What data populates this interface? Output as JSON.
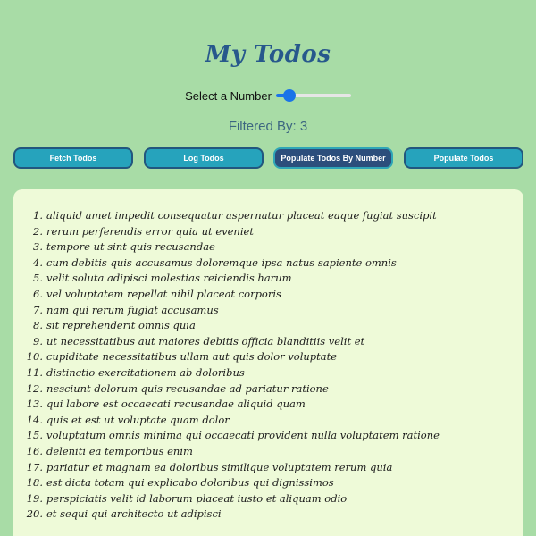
{
  "header": {
    "title": "My Todos"
  },
  "slider": {
    "label": "Select a Number",
    "value_fraction": 0.18
  },
  "filter": {
    "text": "Filtered By: 3"
  },
  "toolbar": {
    "buttons": [
      {
        "label": "Fetch Todos",
        "active": false
      },
      {
        "label": "Log Todos",
        "active": false
      },
      {
        "label": "Populate Todos By Number",
        "active": true
      },
      {
        "label": "Populate Todos",
        "active": false
      }
    ]
  },
  "todos": [
    {
      "num": "1.",
      "text": "aliquid amet impedit consequatur aspernatur placeat eaque fugiat suscipit"
    },
    {
      "num": "2.",
      "text": "rerum perferendis error quia ut eveniet"
    },
    {
      "num": "3.",
      "text": "tempore ut sint quis recusandae"
    },
    {
      "num": "4.",
      "text": "cum debitis quis accusamus doloremque ipsa natus sapiente omnis"
    },
    {
      "num": "5.",
      "text": "velit soluta adipisci molestias reiciendis harum"
    },
    {
      "num": "6.",
      "text": "vel voluptatem repellat nihil placeat corporis"
    },
    {
      "num": "7.",
      "text": "nam qui rerum fugiat accusamus"
    },
    {
      "num": "8.",
      "text": "sit reprehenderit omnis quia"
    },
    {
      "num": "9.",
      "text": "ut necessitatibus aut maiores debitis officia blanditiis velit et"
    },
    {
      "num": "10.",
      "text": "cupiditate necessitatibus ullam aut quis dolor voluptate"
    },
    {
      "num": "11.",
      "text": "distinctio exercitationem ab doloribus"
    },
    {
      "num": "12.",
      "text": "nesciunt dolorum quis recusandae ad pariatur ratione"
    },
    {
      "num": "13.",
      "text": "qui labore est occaecati recusandae aliquid quam"
    },
    {
      "num": "14.",
      "text": "quis et est ut voluptate quam dolor"
    },
    {
      "num": "15.",
      "text": "voluptatum omnis minima qui occaecati provident nulla voluptatem ratione"
    },
    {
      "num": "16.",
      "text": "deleniti ea temporibus enim"
    },
    {
      "num": "17.",
      "text": "pariatur et magnam ea doloribus similique voluptatem rerum quia"
    },
    {
      "num": "18.",
      "text": "est dicta totam qui explicabo doloribus qui dignissimos"
    },
    {
      "num": "19.",
      "text": "perspiciatis velit id laborum placeat iusto et aliquam odio"
    },
    {
      "num": "20.",
      "text": "et sequi qui architecto ut adipisci"
    }
  ]
}
